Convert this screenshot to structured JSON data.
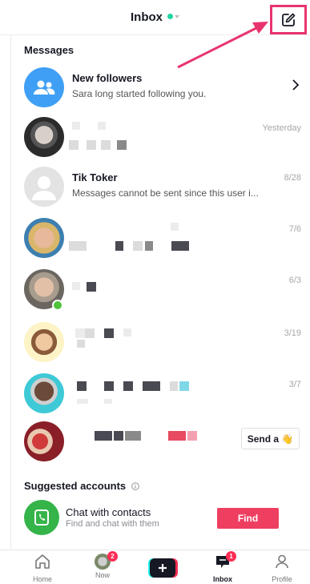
{
  "header": {
    "title": "Inbox",
    "status_color": "#20d5a0",
    "highlight_color": "#e8346e"
  },
  "sections": {
    "messages_title": "Messages",
    "suggested_title": "Suggested accounts"
  },
  "new_followers": {
    "title": "New followers",
    "subtitle": "Sara long started following you."
  },
  "conversations": [
    {
      "name": "",
      "preview": "",
      "time": "Yesterday"
    },
    {
      "name": "Tik Toker",
      "preview": "Messages cannot be sent since this user i...",
      "time": "8/28"
    },
    {
      "name": "",
      "preview": "",
      "time": "7/6"
    },
    {
      "name": "",
      "preview": "",
      "time": "6/3"
    },
    {
      "name": "",
      "preview": "",
      "time": "3/19"
    },
    {
      "name": "",
      "preview": "",
      "time": "3/7"
    },
    {
      "name": "",
      "preview": "",
      "action_label": "Send a 👋"
    }
  ],
  "suggested": {
    "title": "Chat with contacts",
    "subtitle": "Find and chat with them",
    "button_label": "Find",
    "button_color": "#ef3f61"
  },
  "nav": {
    "items": [
      {
        "label": "Home",
        "icon": "home-icon"
      },
      {
        "label": "Now",
        "icon": "now-avatar",
        "badge": "2"
      },
      {
        "label": "",
        "icon": "plus-icon"
      },
      {
        "label": "Inbox",
        "icon": "inbox-icon",
        "badge": "1"
      },
      {
        "label": "Profile",
        "icon": "profile-icon"
      }
    ]
  }
}
